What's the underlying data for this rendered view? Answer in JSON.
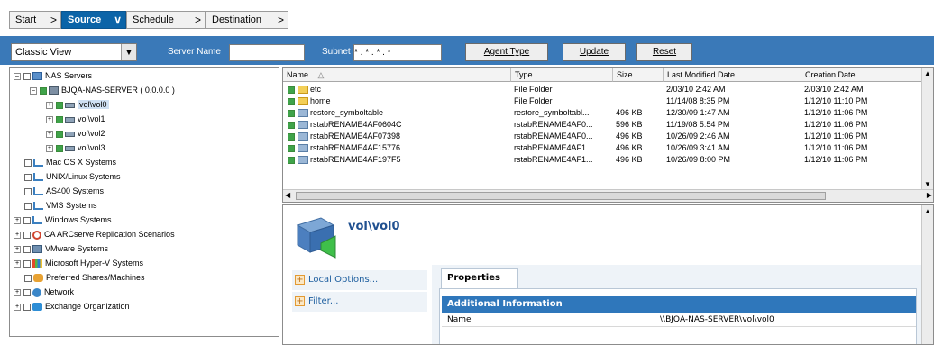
{
  "wizard": {
    "tabs": [
      {
        "label": "Start",
        "arrow": ">"
      },
      {
        "label": "Source",
        "arrow": "∨"
      },
      {
        "label": "Schedule",
        "arrow": ">"
      },
      {
        "label": "Destination",
        "arrow": ">"
      }
    ],
    "active_tab": "Source"
  },
  "toolbar": {
    "view_select": "Classic View",
    "server_name_label": "Server Name",
    "server_name_value": "",
    "subnet_label": "Subnet",
    "subnet_value": " * . * . * . * ",
    "agent_type_button": "Agent Type",
    "update_button": "Update",
    "reset_button": "Reset"
  },
  "tree": {
    "nodes": [
      {
        "label": "NAS Servers",
        "icon": "nas-server-icon"
      },
      {
        "label": "BJQA-NAS-SERVER ( 0.0.0.0 )",
        "icon": "server-icon"
      },
      {
        "label": "vol\\vol0",
        "icon": "volume-icon"
      },
      {
        "label": "vol\\vol1",
        "icon": "volume-icon"
      },
      {
        "label": "vol\\vol2",
        "icon": "volume-icon"
      },
      {
        "label": "vol\\vol3",
        "icon": "volume-icon"
      },
      {
        "label": "Mac OS X Systems",
        "icon": "network-icon"
      },
      {
        "label": "UNIX/Linux Systems",
        "icon": "network-icon"
      },
      {
        "label": "AS400 Systems",
        "icon": "network-icon"
      },
      {
        "label": "VMS Systems",
        "icon": "network-icon"
      },
      {
        "label": "Windows Systems",
        "icon": "network-icon"
      },
      {
        "label": "CA ARCserve Replication Scenarios",
        "icon": "replication-icon"
      },
      {
        "label": "VMware Systems",
        "icon": "vmware-icon"
      },
      {
        "label": "Microsoft Hyper-V Systems",
        "icon": "hyperv-icon"
      },
      {
        "label": "Preferred Shares/Machines",
        "icon": "heart-icon"
      },
      {
        "label": "Network",
        "icon": "globe-icon"
      },
      {
        "label": "Exchange Organization",
        "icon": "exchange-icon"
      }
    ],
    "selected": "vol\\vol0"
  },
  "grid": {
    "columns": [
      "Name",
      "Type",
      "Size",
      "Last Modified Date",
      "Creation Date"
    ],
    "sort_indicator": "△",
    "rows": [
      {
        "name": "etc",
        "type": "File Folder",
        "size": "",
        "modified": "2/03/10  2:42 AM",
        "created": "2/03/10  2:42 AM",
        "icon": "folder-icon"
      },
      {
        "name": "home",
        "type": "File Folder",
        "size": "",
        "modified": "11/14/08  8:35 PM",
        "created": "1/12/10  11:10 PM",
        "icon": "folder-icon"
      },
      {
        "name": "restore_symboltable",
        "type": "restore_symboltabl...",
        "size": "496 KB",
        "modified": "12/30/09  1:47 AM",
        "created": "1/12/10  11:06 PM",
        "icon": "file-icon"
      },
      {
        "name": "rstabRENAME4AF0604C",
        "type": "rstabRENAME4AF0...",
        "size": "596 KB",
        "modified": "11/19/08  5:54 PM",
        "created": "1/12/10  11:06 PM",
        "icon": "file-icon"
      },
      {
        "name": "rstabRENAME4AF07398",
        "type": "rstabRENAME4AF0...",
        "size": "496 KB",
        "modified": "10/26/09  2:46 AM",
        "created": "1/12/10  11:06 PM",
        "icon": "file-icon"
      },
      {
        "name": "rstabRENAME4AF15776",
        "type": "rstabRENAME4AF1...",
        "size": "496 KB",
        "modified": "10/26/09  3:41 AM",
        "created": "1/12/10  11:06 PM",
        "icon": "file-icon"
      },
      {
        "name": "rstabRENAME4AF197F5",
        "type": "rstabRENAME4AF1...",
        "size": "496 KB",
        "modified": "10/26/09  8:00 PM",
        "created": "1/12/10  11:06 PM",
        "icon": "file-icon"
      }
    ]
  },
  "detail": {
    "title": "vol\\vol0",
    "actions": [
      "Local Options...",
      "Filter..."
    ],
    "properties_tab": "Properties",
    "section_header": "Additional Information",
    "property_rows": [
      {
        "key": "Name",
        "value": "\\\\BJQA-NAS-SERVER\\vol\\vol0"
      }
    ]
  },
  "colors": {
    "toolbar_blue": "#3a79b8",
    "active_tab_blue": "#0b64a8",
    "section_header_blue": "#2f77bb",
    "checkbox_green": "#3fa34a",
    "folder_yellow": "#f3cf57"
  }
}
